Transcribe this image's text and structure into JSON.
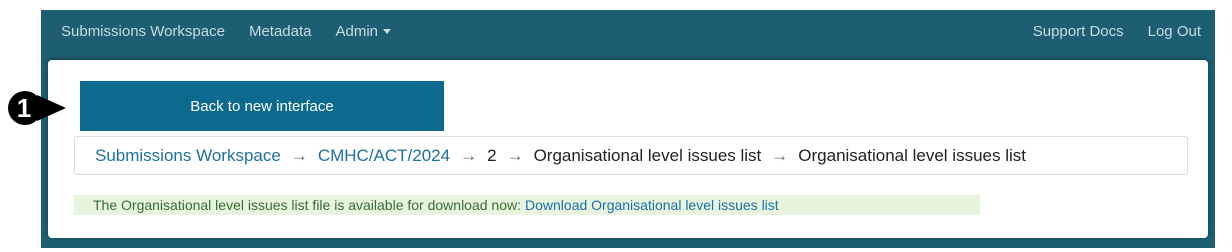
{
  "navbar": {
    "left_items": [
      "Submissions Workspace",
      "Metadata",
      "Admin"
    ],
    "right_items": [
      "Support Docs",
      "Log Out"
    ],
    "admin_icon": "caret-down-icon"
  },
  "back_button": {
    "label": "Back to new interface"
  },
  "step_marker": {
    "number": "1"
  },
  "breadcrumb": {
    "link1": "Submissions Workspace",
    "link2": "CMHC/ACT/2024",
    "item3": "2",
    "item4": "Organisational level issues list",
    "item5": "Organisational level issues list",
    "separator": "→"
  },
  "notice": {
    "text": "The Organisational level issues list file is available for download now:",
    "link": "Download Organisational level issues list"
  },
  "colors": {
    "navbar_bg": "#1d5e73",
    "button_bg": "#0b6a8d",
    "link": "#1d6fa5",
    "notice_bg": "#e7f5df"
  }
}
